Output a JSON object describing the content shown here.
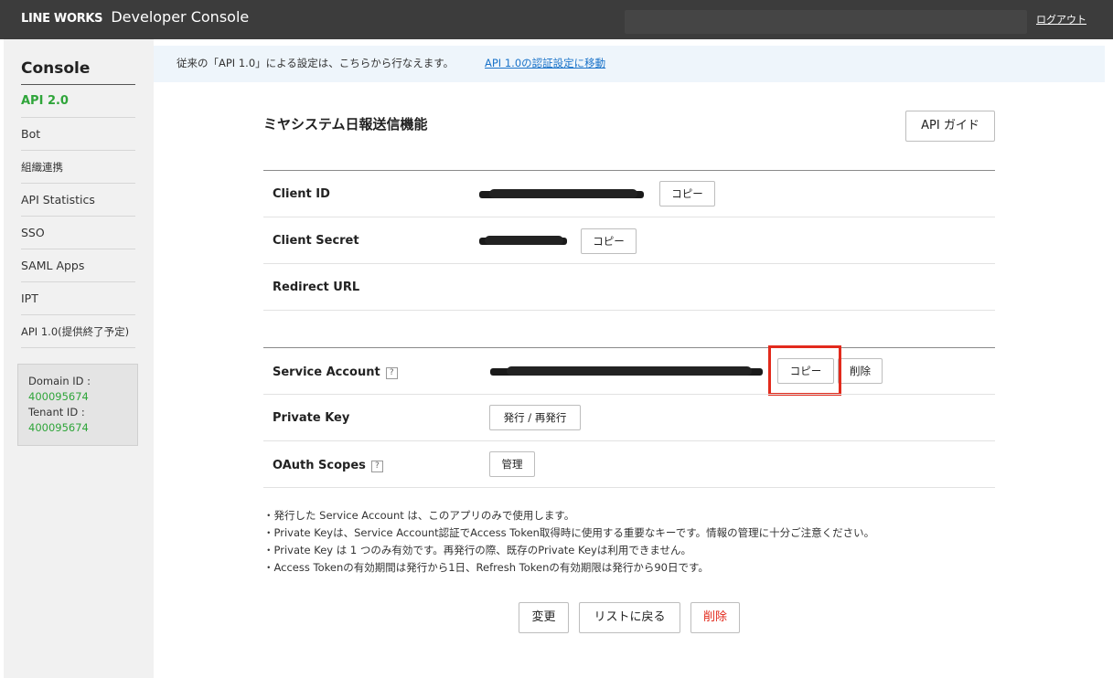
{
  "header": {
    "brand_bold": "LINE WORKS",
    "brand_title": "Developer Console",
    "logout": "ログアウト"
  },
  "sidebar": {
    "title": "Console",
    "items": [
      {
        "label": "API 2.0"
      },
      {
        "label": "Bot"
      },
      {
        "label": "組織連携"
      },
      {
        "label": "API Statistics"
      },
      {
        "label": "SSO"
      },
      {
        "label": "SAML Apps"
      },
      {
        "label": "IPT"
      },
      {
        "label": "API 1.0(提供終了予定)"
      }
    ],
    "domain_label": "Domain ID :",
    "domain_id": "400095674",
    "tenant_label": "Tenant ID :",
    "tenant_id": "400095674"
  },
  "notice": {
    "text": "従来の「API 1.0」による設定は、こちらから行なえます。",
    "link": "API 1.0の認証設定に移動"
  },
  "app": {
    "title": "ミヤシステム日報送信機能",
    "guide_button": "API ガイド"
  },
  "fields": {
    "client_id": {
      "label": "Client ID",
      "copy": "コピー"
    },
    "client_secret": {
      "label": "Client Secret",
      "copy": "コピー"
    },
    "redirect_url": {
      "label": "Redirect URL"
    },
    "service_account": {
      "label": "Service Account",
      "help": "?",
      "copy": "コピー",
      "delete": "削除"
    },
    "private_key": {
      "label": "Private Key",
      "issue": "発行 / 再発行"
    },
    "oauth_scopes": {
      "label": "OAuth Scopes",
      "help": "?",
      "manage": "管理"
    }
  },
  "notes": [
    "・発行した Service Account は、このアプリのみで使用します。",
    "・Private Keyは、Service Account認証でAccess Token取得時に使用する重要なキーです。情報の管理に十分ご注意ください。",
    "・Private Key は 1 つのみ有効です。再発行の際、既存のPrivate Keyは利用できません。",
    "・Access Tokenの有効期間は発行から1日、Refresh Tokenの有効期限は発行から90日です。"
  ],
  "actions": {
    "change": "変更",
    "back": "リストに戻る",
    "delete": "削除"
  },
  "colors": {
    "topbar": "#3c3c3c",
    "accent_green": "#2fa53a",
    "link_blue": "#1a73c9",
    "highlight_red": "#e22a1c"
  }
}
